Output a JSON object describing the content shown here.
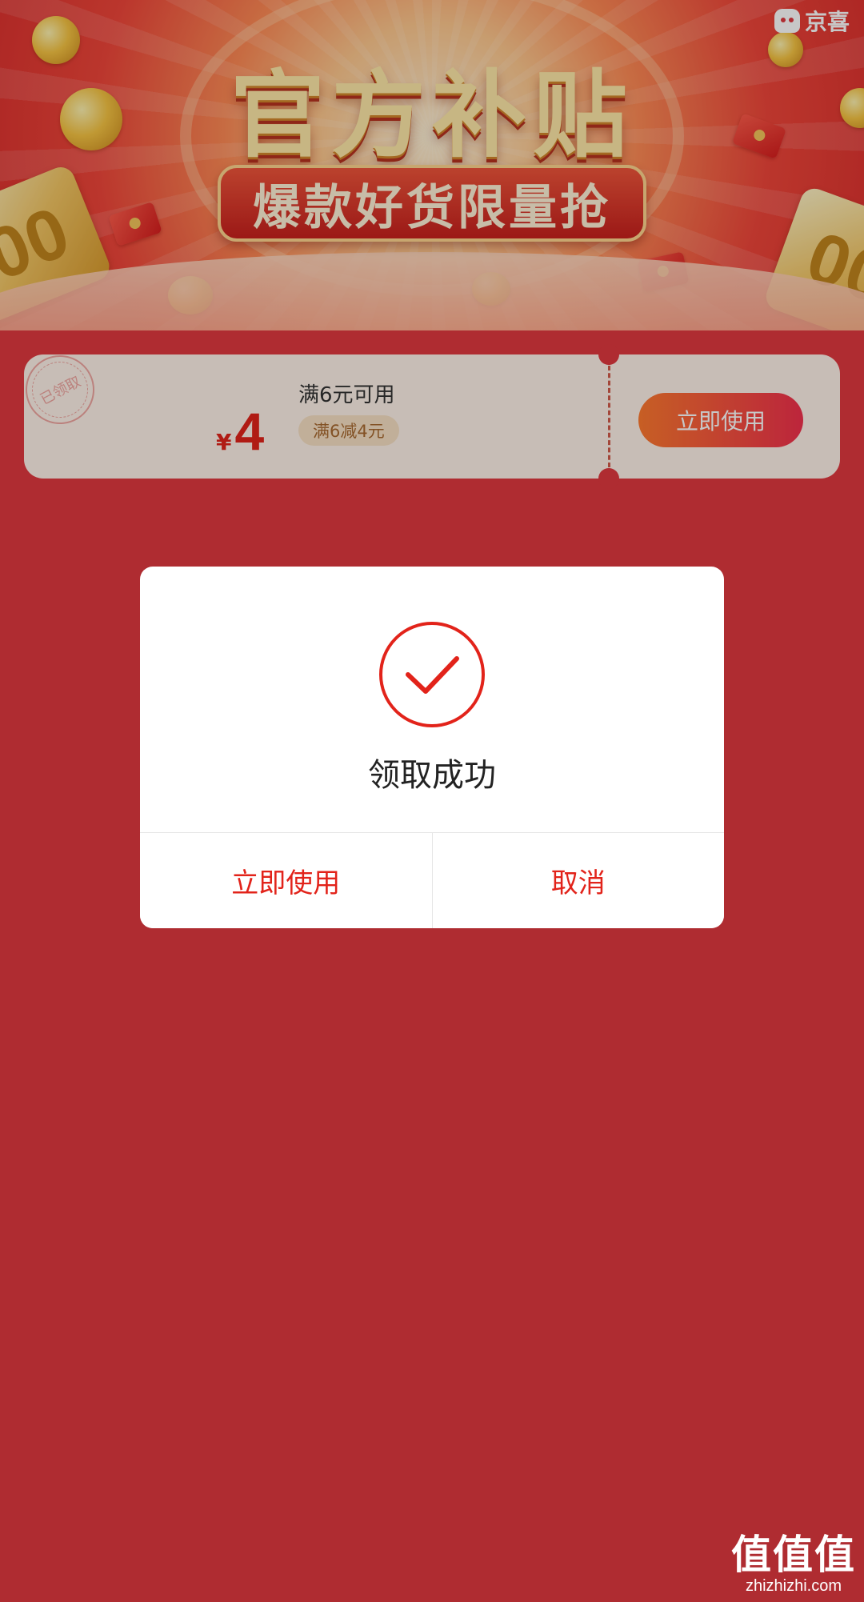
{
  "banner": {
    "title": "官方补贴",
    "subtitle": "爆款好货限量抢",
    "brand": "京喜",
    "card_text": "00"
  },
  "coupon": {
    "stamp": "已领取",
    "currency": "¥",
    "amount": "4",
    "condition": "满6元可用",
    "tag": "满6减4元",
    "action_label": "立即使用"
  },
  "dialog": {
    "message": "领取成功",
    "confirm_label": "立即使用",
    "cancel_label": "取消"
  },
  "watermark": {
    "main": "值值值",
    "sub": "zhizhizhi.com"
  },
  "colors": {
    "background": "#e0393f",
    "accent": "#e2231a",
    "dialog_bg": "#ffffff"
  }
}
